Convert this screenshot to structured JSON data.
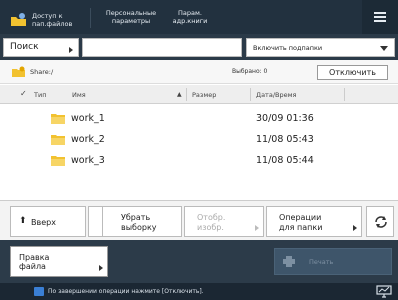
{
  "topbar": {
    "tabs": [
      {
        "label": "Доступ к\nпап.файлов"
      },
      {
        "label": "Персональные\nпараметры"
      },
      {
        "label": "Парам.\nадр.книги"
      }
    ]
  },
  "search": {
    "button_label": "Поиск",
    "input_value": "",
    "subfolder_select": "Включить подпапки"
  },
  "location": {
    "share_path": "Share:/",
    "used_label": "Выбрано: 0",
    "disconnect_label": "Отключить"
  },
  "table": {
    "headers": {
      "type": "Тип",
      "name": "Имя",
      "size": "Размер",
      "date": "Дата/Время"
    },
    "rows": [
      {
        "name": "work_1",
        "date": "30/09 01:36"
      },
      {
        "name": "work_2",
        "date": "11/08 05:43"
      },
      {
        "name": "work_3",
        "date": "11/08 05:44"
      }
    ]
  },
  "actions": {
    "up_label": "Вверх",
    "deselect_label_1": "Убрать",
    "deselect_label_2": "выборку",
    "preview_label_1": "Отобр.",
    "preview_label_2": "изобр.",
    "folder_ops_label_1": "Операции",
    "folder_ops_label_2": "для папки"
  },
  "bottom": {
    "edit_label_1": "Правка",
    "edit_label_2": "файла",
    "print_label": "Печать"
  },
  "status": {
    "text": "По завершении операции нажмите [Отключить]."
  },
  "colors": {
    "topbar": "#22313f",
    "folder": "#f2c230",
    "status_icon": "#3a7fd5"
  }
}
